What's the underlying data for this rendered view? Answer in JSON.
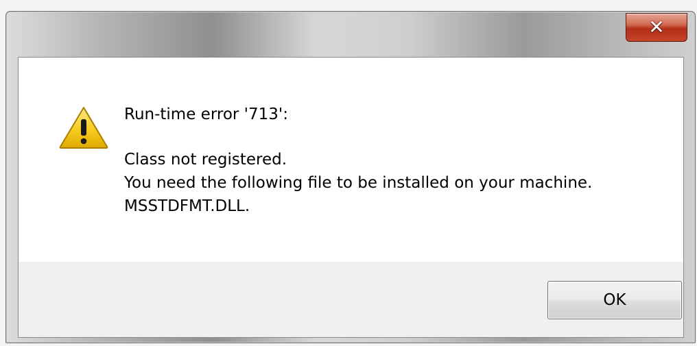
{
  "dialog": {
    "title": "",
    "close_label": "✕",
    "icon": "warning-icon",
    "error_heading": "Run-time error '713':",
    "message_lines": [
      "Class not registered.",
      "You need the following file to be installed on your machine.",
      "MSSTDFMT.DLL."
    ],
    "ok_label": "OK"
  },
  "colors": {
    "close_button": "#c5452b",
    "warning_yellow": "#f3c400",
    "message_background": "#ffffff",
    "button_bar": "#f0f0f0"
  }
}
